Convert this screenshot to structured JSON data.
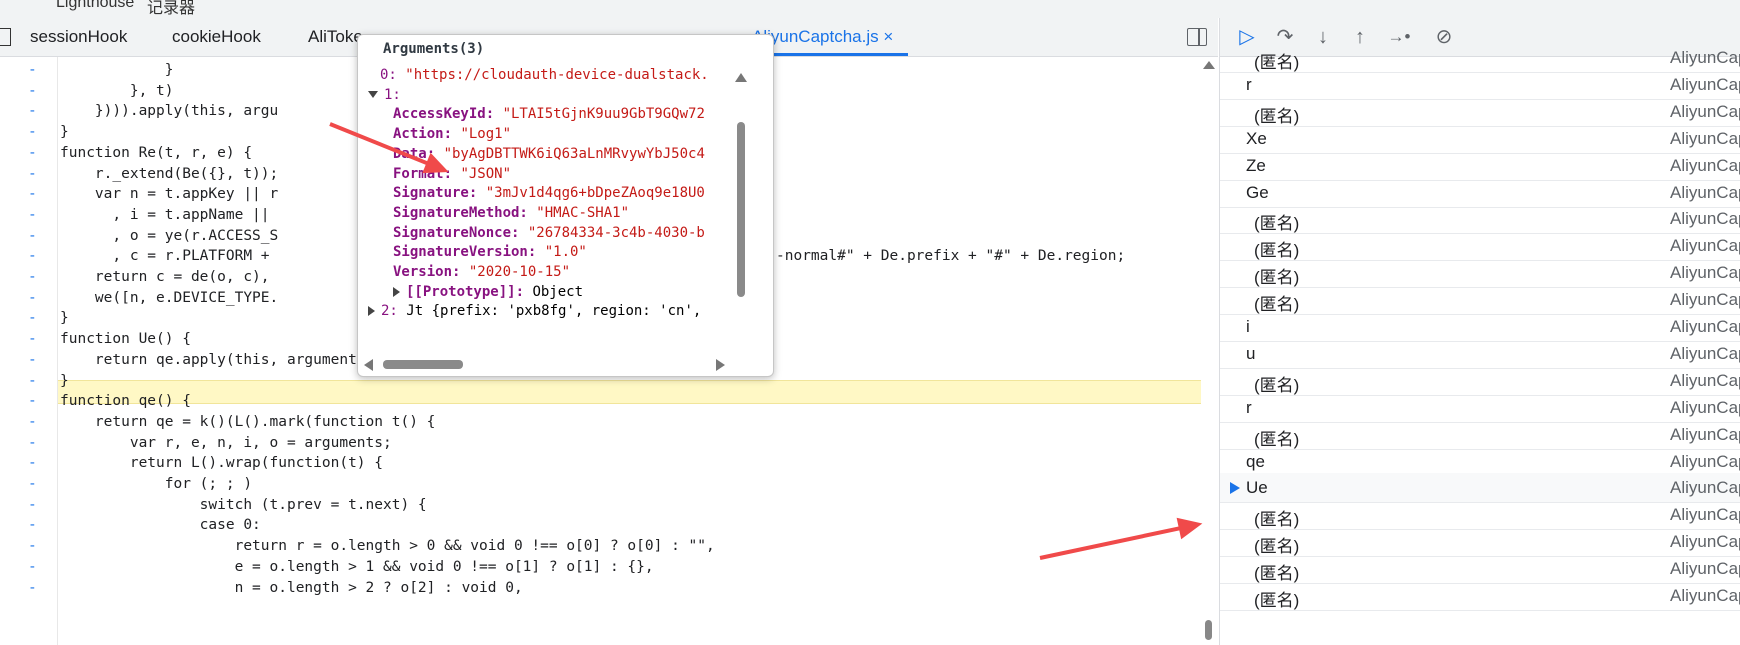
{
  "top_tabs": [
    "Lighthouse",
    "记录器"
  ],
  "source_tabs": [
    {
      "label": "sessionHook",
      "active": false
    },
    {
      "label": "cookieHook",
      "active": false
    },
    {
      "label": "AliToke",
      "active": false
    },
    {
      "label": "AliyunCaptcha.js",
      "active": true
    }
  ],
  "tab_close": "×",
  "code": [
    "            }",
    "        }, t)",
    "    }))).apply(this, argu",
    "}",
    "function Re(t, r, e) {",
    "    r._extend(Be({}, t));",
    "    var n = t.appKey || r",
    "      , i = t.appName ||",
    "      , o = ye(r.ACCESS_S",
    "      , c = r.PLATFORM +",
    "    return c = de(o, c),",
    "    we([n, e.DEVICE_TYPE.",
    "}",
    "function Ue() {",
    "    return qe.apply(this, arguments)",
    "}",
    "function qe() {",
    "    return qe = k()(L().mark(function t() {",
    "        var r, e, n, i, o = arguments;",
    "        return L().wrap(function(t) {",
    "            for (; ; )",
    "                switch (t.prev = t.next) {",
    "                case 0:",
    "                    return r = o.length > 0 && void 0 !== o[0] ? o[0] : \"\",",
    "                    e = o.length > 1 && void 0 !== o[1] ? o[1] : {},",
    "                    n = o.length > 2 ? o[2] : void 0,"
  ],
  "code_tail_line9": "-normal#\" + De.prefix + \"#\" + De.region;",
  "gutter_mark": "-",
  "popup": {
    "title": "Arguments(3)",
    "rows": [
      {
        "key": "0:",
        "value": "\"https://cloudauth-device-dualstack.",
        "indent": 0,
        "toggle": "none"
      },
      {
        "key": "1:",
        "value": "",
        "indent": 0,
        "toggle": "open"
      },
      {
        "key": "AccessKeyId:",
        "value": "\"LTAI5tGjnK9uu9GbT9GQw72",
        "indent": 1,
        "toggle": "none"
      },
      {
        "key": "Action:",
        "value": "\"Log1\"",
        "indent": 1,
        "toggle": "none"
      },
      {
        "key": "Data:",
        "value": "\"byAgDBTTWK6iQ63aLnMRvywYbJ50c4",
        "indent": 1,
        "toggle": "none"
      },
      {
        "key": "Format:",
        "value": "\"JSON\"",
        "indent": 1,
        "toggle": "none"
      },
      {
        "key": "Signature:",
        "value": "\"3mJv1d4qg6+bDpeZAoq9e18U0",
        "indent": 1,
        "toggle": "none"
      },
      {
        "key": "SignatureMethod:",
        "value": "\"HMAC-SHA1\"",
        "indent": 1,
        "toggle": "none"
      },
      {
        "key": "SignatureNonce:",
        "value": "\"26784334-3c4b-4030-b",
        "indent": 1,
        "toggle": "none"
      },
      {
        "key": "SignatureVersion:",
        "value": "\"1.0\"",
        "indent": 1,
        "toggle": "none"
      },
      {
        "key": "Version:",
        "value": "\"2020-10-15\"",
        "indent": 1,
        "toggle": "none"
      },
      {
        "key": "[[Prototype]]:",
        "value": "Object",
        "indent": 1,
        "toggle": "closed"
      },
      {
        "key": "2:",
        "value": "Jt {prefix: 'pxb8fg', region: 'cn',",
        "indent": 0,
        "toggle": "closed"
      }
    ]
  },
  "call_stack": [
    {
      "name": "(匿名)",
      "location": "AliyunCap",
      "indent": true,
      "current": false
    },
    {
      "name": "r",
      "location": "AliyunCap",
      "indent": false,
      "current": false
    },
    {
      "name": "(匿名)",
      "location": "AliyunCap",
      "indent": true,
      "current": false
    },
    {
      "name": "Xe",
      "location": "AliyunCap",
      "indent": false,
      "current": false
    },
    {
      "name": "Ze",
      "location": "AliyunCap",
      "indent": false,
      "current": false
    },
    {
      "name": "Ge",
      "location": "AliyunCap",
      "indent": false,
      "current": false
    },
    {
      "name": "(匿名)",
      "location": "AliyunCap",
      "indent": true,
      "current": false
    },
    {
      "name": "(匿名)",
      "location": "AliyunCap",
      "indent": true,
      "current": false
    },
    {
      "name": "(匿名)",
      "location": "AliyunCap",
      "indent": true,
      "current": false
    },
    {
      "name": "(匿名)",
      "location": "AliyunCap",
      "indent": true,
      "current": false
    },
    {
      "name": "i",
      "location": "AliyunCap",
      "indent": false,
      "current": false
    },
    {
      "name": "u",
      "location": "AliyunCap",
      "indent": false,
      "current": false
    },
    {
      "name": "(匿名)",
      "location": "AliyunCap",
      "indent": true,
      "current": false
    },
    {
      "name": "r",
      "location": "AliyunCap",
      "indent": false,
      "current": false
    },
    {
      "name": "(匿名)",
      "location": "AliyunCap",
      "indent": true,
      "current": false
    },
    {
      "name": "qe",
      "location": "AliyunCap",
      "indent": false,
      "current": false
    },
    {
      "name": "Ue",
      "location": "AliyunCap",
      "indent": false,
      "current": true
    },
    {
      "name": "(匿名)",
      "location": "AliyunCap",
      "indent": true,
      "current": false
    },
    {
      "name": "(匿名)",
      "location": "AliyunCap",
      "indent": true,
      "current": false
    },
    {
      "name": "(匿名)",
      "location": "AliyunCap",
      "indent": true,
      "current": false
    },
    {
      "name": "(匿名)",
      "location": "AliyunCap",
      "indent": true,
      "current": false
    }
  ],
  "debugger_buttons": [
    {
      "icon": "resume-icon",
      "glyph": "▷"
    },
    {
      "icon": "step-over-icon",
      "glyph": "↷"
    },
    {
      "icon": "step-into-icon",
      "glyph": "↓"
    },
    {
      "icon": "step-out-icon",
      "glyph": "↑"
    },
    {
      "icon": "step-icon",
      "glyph": "→•"
    },
    {
      "icon": "deactivate-breakpoints-icon",
      "glyph": "⊘"
    }
  ],
  "colors": {
    "accent": "#1a73e8",
    "annotation_arrow": "#f04a4a",
    "highlight": "#fff8c5"
  }
}
